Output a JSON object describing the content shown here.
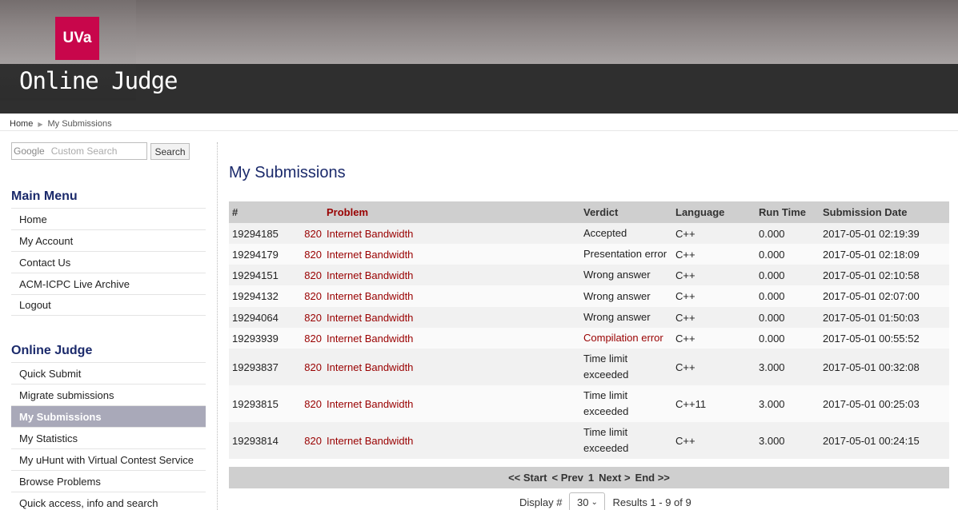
{
  "header": {
    "logo_text": "UVa",
    "site_title": "Online Judge"
  },
  "breadcrumb": {
    "home": "Home",
    "current": "My Submissions"
  },
  "search": {
    "brand": "Google",
    "placeholder": "Custom Search",
    "button_label": "Search"
  },
  "main_menu": {
    "heading": "Main Menu",
    "items": [
      {
        "label": "Home"
      },
      {
        "label": "My Account"
      },
      {
        "label": "Contact Us"
      },
      {
        "label": "ACM-ICPC Live Archive"
      },
      {
        "label": "Logout"
      }
    ]
  },
  "online_judge_menu": {
    "heading": "Online Judge",
    "items": [
      {
        "label": "Quick Submit"
      },
      {
        "label": "Migrate submissions"
      },
      {
        "label": "My Submissions",
        "active": true
      },
      {
        "label": "My Statistics"
      },
      {
        "label": "My uHunt with Virtual Contest Service"
      },
      {
        "label": "Browse Problems"
      },
      {
        "label": "Quick access, info and search"
      }
    ]
  },
  "main": {
    "title": "My Submissions",
    "columns": {
      "id": "#",
      "problem": "Problem",
      "verdict": "Verdict",
      "language": "Language",
      "run_time": "Run Time",
      "date": "Submission Date"
    },
    "rows": [
      {
        "id": "19294185",
        "pnum": "820",
        "pname": "Internet Bandwidth",
        "verdict": "Accepted",
        "lang": "C++",
        "run": "0.000",
        "date": "2017-05-01 02:19:39"
      },
      {
        "id": "19294179",
        "pnum": "820",
        "pname": "Internet Bandwidth",
        "verdict": "Presentation error",
        "lang": "C++",
        "run": "0.000",
        "date": "2017-05-01 02:18:09"
      },
      {
        "id": "19294151",
        "pnum": "820",
        "pname": "Internet Bandwidth",
        "verdict": "Wrong answer",
        "lang": "C++",
        "run": "0.000",
        "date": "2017-05-01 02:10:58"
      },
      {
        "id": "19294132",
        "pnum": "820",
        "pname": "Internet Bandwidth",
        "verdict": "Wrong answer",
        "lang": "C++",
        "run": "0.000",
        "date": "2017-05-01 02:07:00"
      },
      {
        "id": "19294064",
        "pnum": "820",
        "pname": "Internet Bandwidth",
        "verdict": "Wrong answer",
        "lang": "C++",
        "run": "0.000",
        "date": "2017-05-01 01:50:03"
      },
      {
        "id": "19293939",
        "pnum": "820",
        "pname": "Internet Bandwidth",
        "verdict": "Compilation error",
        "lang": "C++",
        "run": "0.000",
        "date": "2017-05-01 00:55:52"
      },
      {
        "id": "19293837",
        "pnum": "820",
        "pname": "Internet Bandwidth",
        "verdict": "Time limit exceeded",
        "lang": "C++",
        "run": "3.000",
        "date": "2017-05-01 00:32:08"
      },
      {
        "id": "19293815",
        "pnum": "820",
        "pname": "Internet Bandwidth",
        "verdict": "Time limit exceeded",
        "lang": "C++11",
        "run": "3.000",
        "date": "2017-05-01 00:25:03"
      },
      {
        "id": "19293814",
        "pnum": "820",
        "pname": "Internet Bandwidth",
        "verdict": "Time limit exceeded",
        "lang": "C++",
        "run": "3.000",
        "date": "2017-05-01 00:24:15"
      }
    ],
    "pager": {
      "start": "<< Start",
      "prev": "< Prev",
      "page": "1",
      "next": "Next >",
      "end": "End >>"
    },
    "display": {
      "label": "Display #",
      "selected": "30",
      "results": "Results 1 - 9 of 9"
    }
  },
  "colors": {
    "logo_bg": "#c8064b",
    "heading": "#1b2a6b",
    "link_red": "#990000",
    "active_menu_bg": "#a9a9b9"
  }
}
